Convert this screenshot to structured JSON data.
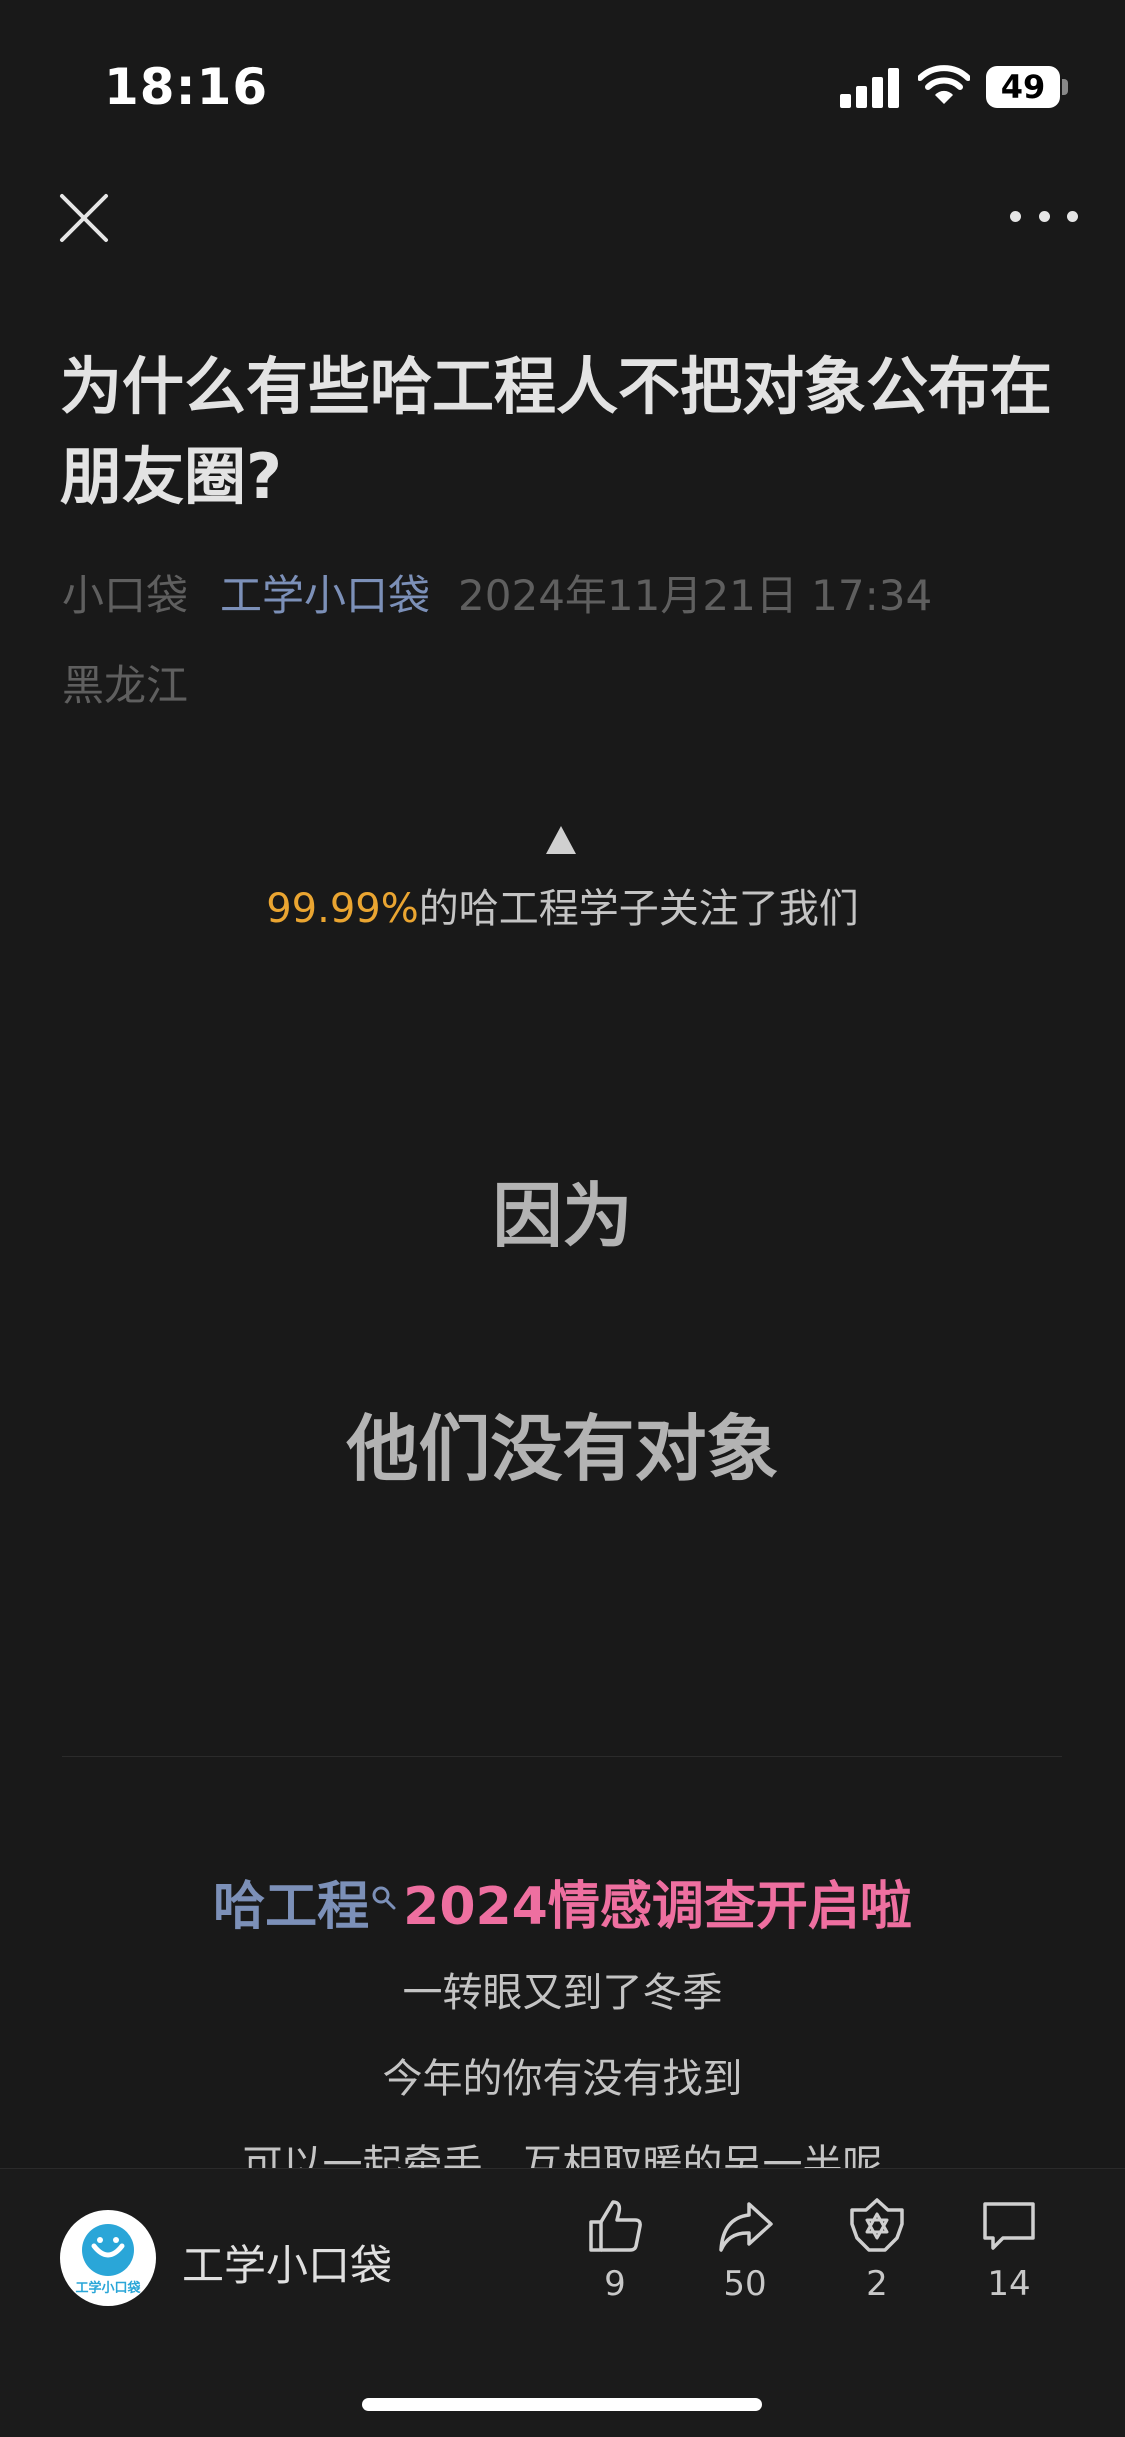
{
  "status": {
    "time": "18:16",
    "battery": "49"
  },
  "article": {
    "title": "为什么有些哈工程人不把对象公布在朋友圈?",
    "author": "小口袋",
    "account": "工学小口袋",
    "datetime": "2024年11月21日 17:34",
    "location": "黑龙江"
  },
  "follow": {
    "percent": "99.99%",
    "text": "的哈工程学子关注了我们"
  },
  "body": {
    "line1": "因为",
    "line2": "他们没有对象",
    "survey_part1": "哈工程",
    "survey_part2": "2024情感调查开启啦",
    "para1": "一转眼又到了冬季",
    "para2": "今年的你有没有找到",
    "para3": "可以一起牵手、互相取暖的另一半呢"
  },
  "bottom": {
    "account_name": "工学小口袋",
    "avatar_text": "工学小口袋",
    "likes": "9",
    "shares": "50",
    "recommend": "2",
    "comments": "14"
  },
  "colors": {
    "background": "#191919",
    "accent_blue": "#7c90b8",
    "accent_orange": "#eaa531",
    "accent_pink": "#ee6fa0"
  },
  "icons": [
    "close-icon",
    "more-icon",
    "like-icon",
    "share-icon",
    "recommend-icon",
    "comment-icon",
    "search-icon"
  ]
}
